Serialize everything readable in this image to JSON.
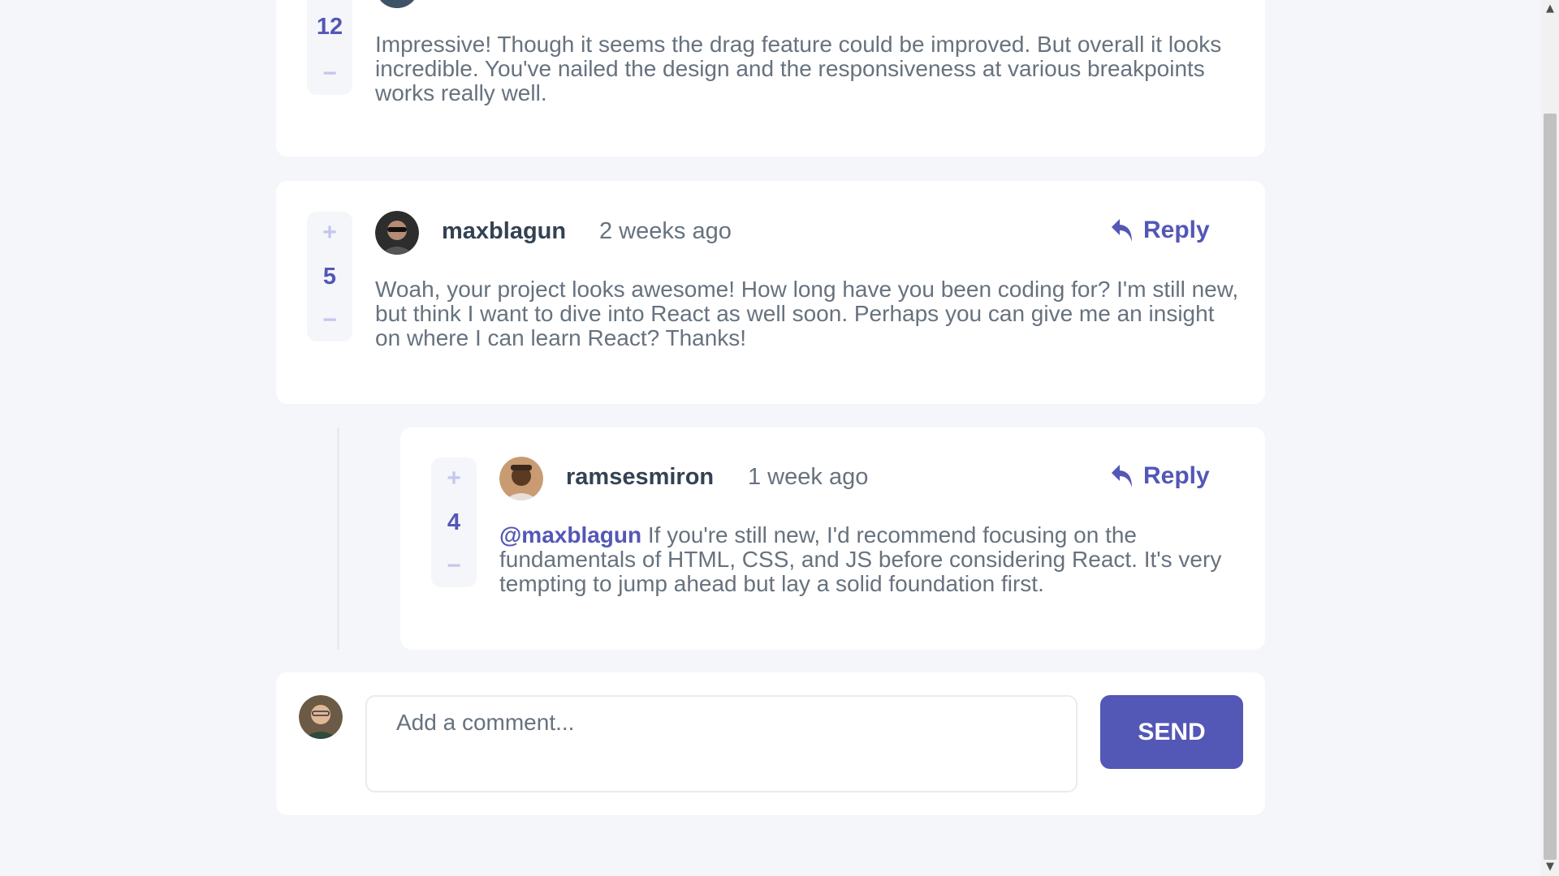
{
  "comments": [
    {
      "score": "12",
      "text": "Impressive! Though it seems the drag feature could be improved. But overall it looks incredible. You've nailed the design and the responsiveness at various breakpoints works really well."
    },
    {
      "username": "maxblagun",
      "time": "2 weeks ago",
      "score": "5",
      "reply_label": "Reply",
      "text": "Woah, your project looks awesome! How long have you been coding for? I'm still new, but think I want to dive into React as well soon. Perhaps you can give me an insight on where I can learn React? Thanks!"
    }
  ],
  "replies": [
    {
      "username": "ramsesmiron",
      "time": "1 week ago",
      "score": "4",
      "reply_label": "Reply",
      "mention": "@maxblagun",
      "text": " If you're still new, I'd recommend focusing on the fundamentals of HTML, CSS, and JS before considering React. It's very tempting to jump ahead but lay a solid foundation first."
    }
  ],
  "vote": {
    "plus": "+",
    "minus": "−"
  },
  "new_comment": {
    "placeholder": "Add a comment...",
    "send_label": "SEND"
  },
  "colors": {
    "primary": "#5357b6",
    "background": "#f5f6fa",
    "text": "#67727e",
    "username": "#334253",
    "vote_icon": "#c5c6ef"
  }
}
